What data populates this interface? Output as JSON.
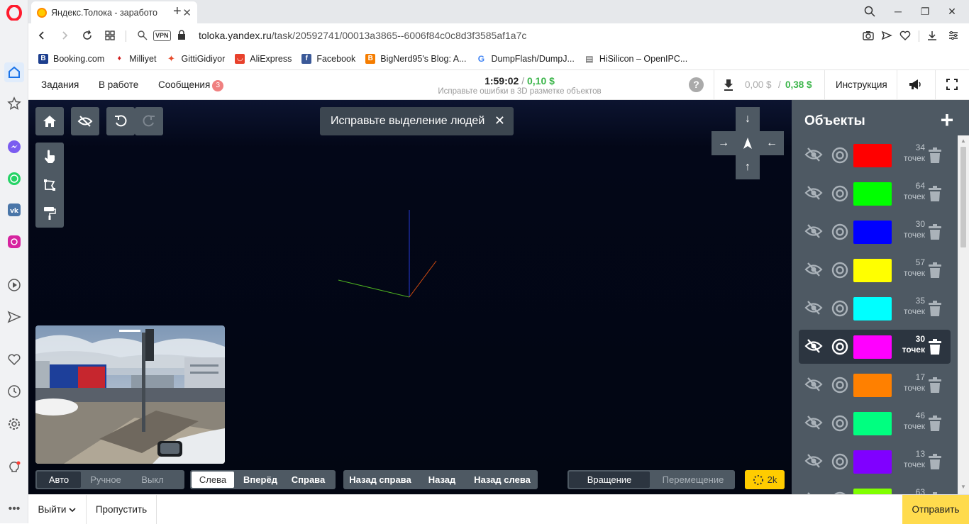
{
  "browser": {
    "tab_title": "Яндекс.Толока - заработо",
    "url_host": "toloka.yandex.ru",
    "url_path": "/task/20592741/00013a3865--6006f84c0c8d3f3585af1a7c",
    "vpn_label": "VPN"
  },
  "bookmarks": [
    {
      "label": "Booking.com",
      "icon": "booking-icon",
      "color": "#1d3f8e",
      "glyph": "B"
    },
    {
      "label": "Milliyet",
      "icon": "milliyet-icon",
      "color": "#d01c1c",
      "glyph": "♦"
    },
    {
      "label": "GittiGidiyor",
      "icon": "gittigidiyor-icon",
      "color": "#e64b2b",
      "glyph": "✦"
    },
    {
      "label": "AliExpress",
      "icon": "aliexpress-icon",
      "color": "#e8412c",
      "glyph": "◡"
    },
    {
      "label": "Facebook",
      "icon": "facebook-icon",
      "color": "#3b5998",
      "glyph": "f"
    },
    {
      "label": "BigNerd95's Blog: A...",
      "icon": "blogger-icon",
      "color": "#f57d00",
      "glyph": "B"
    },
    {
      "label": "DumpFlash/DumpJ...",
      "icon": "google-icon",
      "color": "#ffffff",
      "glyph": "G"
    },
    {
      "label": "HiSilicon – OpenIPC...",
      "icon": "page-icon",
      "color": "#ffffff",
      "glyph": "▤"
    }
  ],
  "header": {
    "tasks": "Задания",
    "in_progress": "В работе",
    "messages": "Сообщения",
    "messages_count": "3",
    "timer": "1:59:02",
    "separator": "/",
    "reward": "0,10 $",
    "subtitle": "Исправьте ошибки в 3D разметке объектов",
    "balance_hold": "0,00 $",
    "balance_sep": "/",
    "balance": "0,38 $",
    "instructions": "Инструкция"
  },
  "viewer": {
    "hint": "Исправьте выделение людей",
    "auto_mode": [
      "Авто",
      "Ручное",
      "Выкл"
    ],
    "views_front": [
      "Слева",
      "Вперёд",
      "Справа"
    ],
    "views_back": [
      "Назад справа",
      "Назад",
      "Назад слева"
    ],
    "control_mode": [
      "Вращение",
      "Перемещение"
    ],
    "quality": "2k"
  },
  "objects": {
    "title": "Объекты",
    "points_unit": "точек",
    "items": [
      {
        "count": "34",
        "color": "#ff0000"
      },
      {
        "count": "64",
        "color": "#00ff00"
      },
      {
        "count": "30",
        "color": "#0000ff"
      },
      {
        "count": "57",
        "color": "#ffff00"
      },
      {
        "count": "35",
        "color": "#00ffff"
      },
      {
        "count": "30",
        "color": "#ff00ff",
        "selected": true
      },
      {
        "count": "17",
        "color": "#ff8000"
      },
      {
        "count": "46",
        "color": "#00ff80"
      },
      {
        "count": "13",
        "color": "#8000ff"
      },
      {
        "count": "63",
        "color": "#80ff00"
      }
    ]
  },
  "footer": {
    "exit": "Выйти",
    "skip": "Пропустить",
    "submit": "Отправить"
  }
}
